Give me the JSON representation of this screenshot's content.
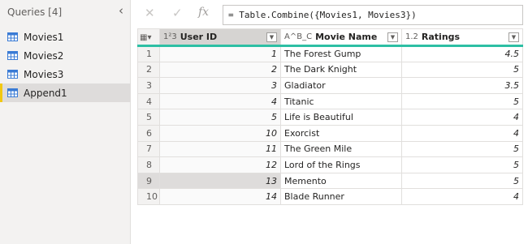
{
  "queries": {
    "header": "Queries [4]",
    "collapse_icon": "‹",
    "items": [
      {
        "label": "Movies1",
        "icon": "table-icon",
        "selected": false
      },
      {
        "label": "Movies2",
        "icon": "table-icon",
        "selected": false
      },
      {
        "label": "Movies3",
        "icon": "table-icon",
        "selected": false
      },
      {
        "label": "Append1",
        "icon": "table-icon",
        "selected": true
      }
    ]
  },
  "formula_bar": {
    "cancel": "✕",
    "commit": "✓",
    "fx": "fx",
    "formula": "= Table.Combine({Movies1, Movies3})"
  },
  "grid": {
    "corner_icon": "▦▾",
    "columns": [
      {
        "type_icon": "1²3",
        "label": "User ID"
      },
      {
        "type_icon": "A^B_C",
        "label": "Movie Name"
      },
      {
        "type_icon": "1.2",
        "label": "Ratings"
      }
    ],
    "rows": [
      {
        "n": "1",
        "user_id": "1",
        "movie": "The Forest Gump",
        "rating": "4.5"
      },
      {
        "n": "2",
        "user_id": "2",
        "movie": "The Dark Knight",
        "rating": "5"
      },
      {
        "n": "3",
        "user_id": "3",
        "movie": "Gladiator",
        "rating": "3.5"
      },
      {
        "n": "4",
        "user_id": "4",
        "movie": "Titanic",
        "rating": "5"
      },
      {
        "n": "5",
        "user_id": "5",
        "movie": "Life is Beautiful",
        "rating": "4"
      },
      {
        "n": "6",
        "user_id": "10",
        "movie": "Exorcist",
        "rating": "4"
      },
      {
        "n": "7",
        "user_id": "11",
        "movie": "The Green Mile",
        "rating": "5"
      },
      {
        "n": "8",
        "user_id": "12",
        "movie": "Lord of the Rings",
        "rating": "5"
      },
      {
        "n": "9",
        "user_id": "13",
        "movie": "Memento",
        "rating": "5"
      },
      {
        "n": "10",
        "user_id": "14",
        "movie": "Blade Runner",
        "rating": "4"
      }
    ],
    "selected_row": 8
  },
  "colors": {
    "accent_teal": "#2dbfa4",
    "selected_marker": "#f2c811",
    "table_icon_blue": "#3a7bd5"
  }
}
